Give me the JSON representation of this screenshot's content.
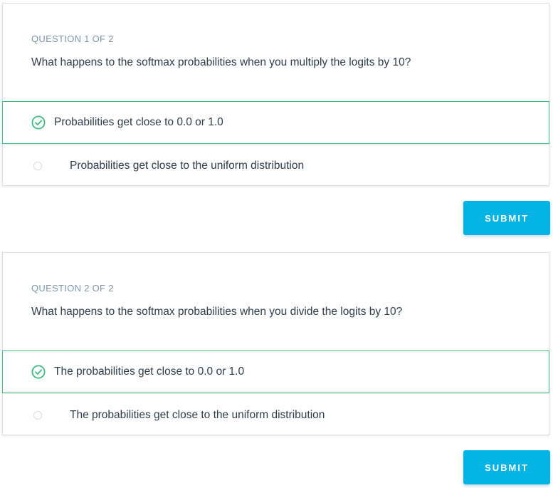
{
  "questions": [
    {
      "label": "QUESTION 1 OF 2",
      "text": "What happens to the softmax probabilities when you multiply the logits by 10?",
      "options": [
        {
          "label": "Probabilities get close to 0.0 or 1.0",
          "selected": true,
          "correct": true
        },
        {
          "label": "Probabilities get close to the uniform distribution",
          "selected": false
        }
      ],
      "submit_label": "SUBMIT"
    },
    {
      "label": "QUESTION 2 OF 2",
      "text": "What happens to the softmax probabilities when you divide the logits by 10?",
      "options": [
        {
          "label": "The probabilities get close to 0.0 or 1.0",
          "selected": true,
          "correct": true
        },
        {
          "label": "The probabilities get close to the uniform distribution",
          "selected": false
        }
      ],
      "submit_label": "SUBMIT"
    }
  ],
  "colors": {
    "accent": "#02b3e4",
    "correct_green": "#3ebc7e",
    "text": "#2e3d49",
    "muted": "#7d97ad"
  },
  "icons": {
    "selected": "check-circle-icon",
    "unselected": "radio-circle-icon"
  }
}
